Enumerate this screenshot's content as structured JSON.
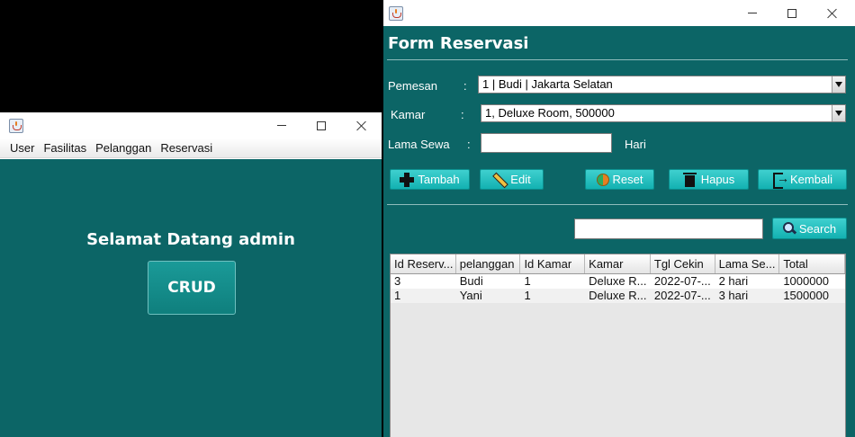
{
  "left_window": {
    "menu": [
      "User",
      "Fasilitas",
      "Pelanggan",
      "Reservasi"
    ],
    "welcome_text": "Selamat Datang admin",
    "crud_label": "CRUD"
  },
  "right_window": {
    "title": "Form Reservasi",
    "form": {
      "pemesan_label": "Pemesan",
      "pemesan_colon": ":",
      "pemesan_value": "1 | Budi | Jakarta Selatan",
      "kamar_label": "Kamar",
      "kamar_colon": ":",
      "kamar_value": "1, Deluxe Room, 500000",
      "lama_label": "Lama Sewa",
      "lama_colon": ":",
      "lama_value": "",
      "lama_unit": "Hari"
    },
    "buttons": {
      "tambah": "Tambah",
      "edit": "Edit",
      "reset": "Reset",
      "hapus": "Hapus",
      "kembali": "Kembali"
    },
    "search": {
      "value": "",
      "button": "Search"
    },
    "table": {
      "columns": [
        "Id Reserv...",
        "pelanggan",
        "Id Kamar",
        "Kamar",
        "Tgl Cekin",
        "Lama Se...",
        "Total"
      ],
      "rows": [
        [
          "3",
          "Budi",
          "1",
          "Deluxe R...",
          "2022-07-...",
          "2 hari",
          "1000000"
        ],
        [
          "1",
          "Yani",
          "1",
          "Deluxe R...",
          "2022-07-...",
          "3 hari",
          "1500000"
        ]
      ]
    }
  },
  "colors": {
    "panel_background": "#0c6566",
    "button_teal": "#27c4c3",
    "crud_button": "#158c8a"
  }
}
